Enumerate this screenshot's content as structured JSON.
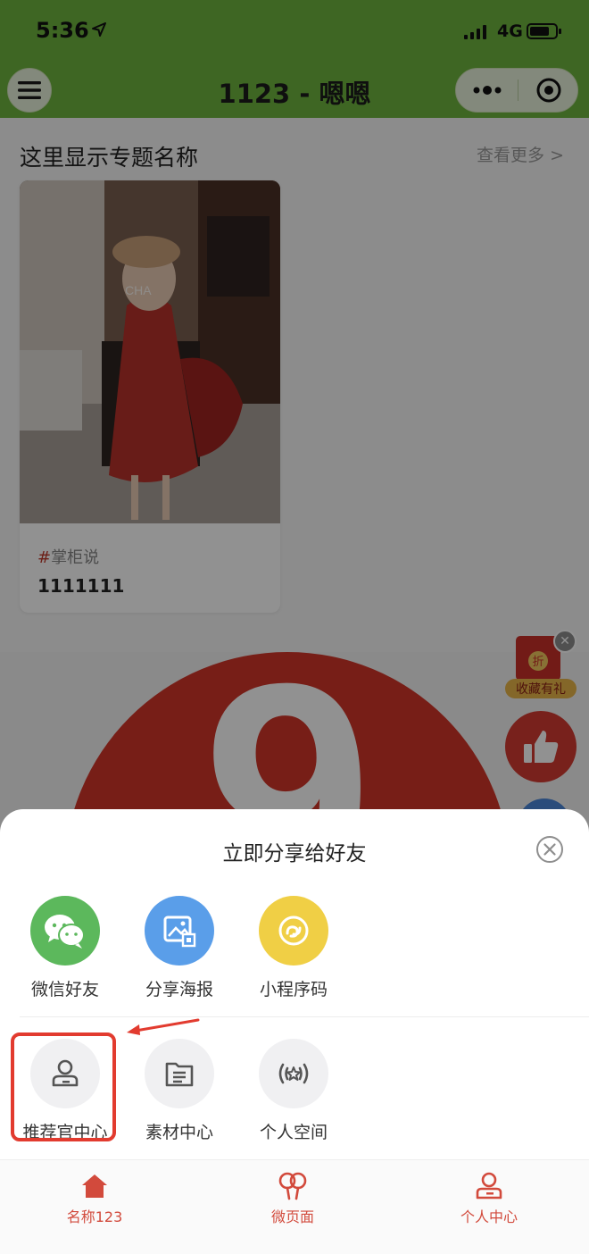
{
  "status_bar": {
    "time": "5:36",
    "network": "4G"
  },
  "nav": {
    "title": "1123 - 嗯嗯"
  },
  "section": {
    "title": "这里显示专题名称",
    "more": "查看更多 >"
  },
  "card": {
    "tag_hash": "#",
    "tag_text": "掌柜说",
    "title": "1111111",
    "photo_text": "CHA"
  },
  "banner": {
    "number": "9"
  },
  "floating": {
    "gift_badge": "折",
    "gift_label": "收藏有礼"
  },
  "share_sheet": {
    "title": "立即分享给好友",
    "row1": [
      {
        "label": "微信好友",
        "icon": "wechat-icon",
        "color": "#5cb85c"
      },
      {
        "label": "分享海报",
        "icon": "poster-icon",
        "color": "#5a9ee9"
      },
      {
        "label": "小程序码",
        "icon": "mini-program-code-icon",
        "color": "#f0cf45"
      }
    ],
    "row2": [
      {
        "label": "推荐官中心",
        "icon": "user-icon"
      },
      {
        "label": "素材中心",
        "icon": "folder-icon"
      },
      {
        "label": "个人空间",
        "icon": "star-broadcast-icon"
      }
    ]
  },
  "tab_bar": {
    "tabs": [
      {
        "label": "名称123",
        "icon": "home-icon"
      },
      {
        "label": "微页面",
        "icon": "balloons-icon"
      },
      {
        "label": "个人中心",
        "icon": "user-icon"
      }
    ]
  },
  "colors": {
    "nav_green": "#6db33f",
    "accent_red": "#d24a3c",
    "highlight_red": "#e23b2f"
  }
}
